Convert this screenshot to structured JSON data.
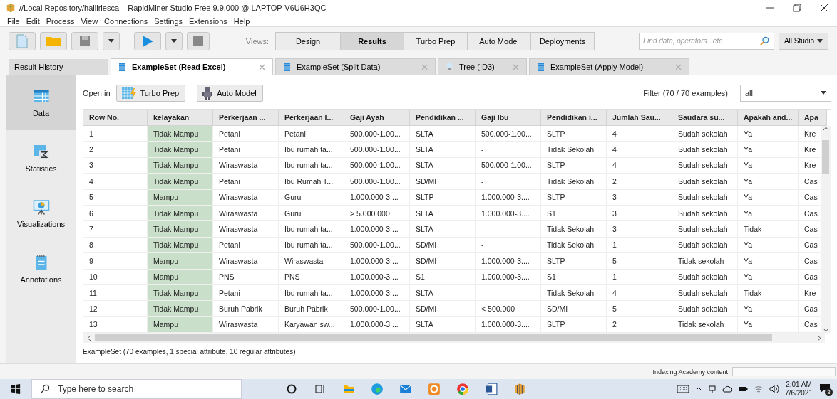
{
  "window": {
    "title": "//Local Repository/haiiiriesca – RapidMiner Studio Free 9.9.000 @ LAPTOP-V6U6H3QC"
  },
  "menu": [
    "File",
    "Edit",
    "Process",
    "View",
    "Connections",
    "Settings",
    "Extensions",
    "Help"
  ],
  "views": {
    "label": "Views:",
    "items": [
      {
        "label": "Design",
        "selected": false
      },
      {
        "label": "Results",
        "selected": true
      },
      {
        "label": "Turbo Prep",
        "selected": false
      },
      {
        "label": "Auto Model",
        "selected": false
      },
      {
        "label": "Deployments",
        "selected": false
      }
    ]
  },
  "search": {
    "placeholder": "Find data, operators...etc",
    "scope": "All Studio"
  },
  "result_history": "Result History",
  "tabs": [
    {
      "label": "ExampleSet (Read Excel)",
      "kind": "data",
      "selected": true
    },
    {
      "label": "ExampleSet (Split Data)",
      "kind": "data",
      "selected": false
    },
    {
      "label": "Tree (ID3)",
      "kind": "model",
      "selected": false
    },
    {
      "label": "ExampleSet (Apply Model)",
      "kind": "data",
      "selected": false
    }
  ],
  "sidebar": [
    {
      "label": "Data",
      "kind": "data",
      "selected": true
    },
    {
      "label": "Statistics",
      "kind": "statistics",
      "selected": false
    },
    {
      "label": "Visualizations",
      "kind": "visualizations",
      "selected": false
    },
    {
      "label": "Annotations",
      "kind": "annotations",
      "selected": false
    }
  ],
  "open_in": {
    "label": "Open in",
    "buttons": [
      {
        "label": "Turbo Prep",
        "kind": "turbo"
      },
      {
        "label": "Auto Model",
        "kind": "robot"
      }
    ]
  },
  "filter": {
    "label": "Filter (70 / 70 examples):",
    "value": "all"
  },
  "table": {
    "columns": [
      {
        "label": "Row No.",
        "highlighted": false
      },
      {
        "label": "kelayakan",
        "highlighted": true
      },
      {
        "label": "Perkerjaan ...",
        "highlighted": false
      },
      {
        "label": "Perkerjaan I...",
        "highlighted": false
      },
      {
        "label": "Gaji Ayah",
        "highlighted": false
      },
      {
        "label": "Pendidikan ...",
        "highlighted": false
      },
      {
        "label": "Gaji Ibu",
        "highlighted": false
      },
      {
        "label": "Pendidikan i...",
        "highlighted": false
      },
      {
        "label": "Jumlah Sau...",
        "highlighted": false
      },
      {
        "label": "Saudara su...",
        "highlighted": false
      },
      {
        "label": "Apakah and...",
        "highlighted": false
      },
      {
        "label": "Apa",
        "highlighted": false
      }
    ],
    "rows": [
      [
        "1",
        "Tidak Mampu",
        "Petani",
        "Petani",
        "500.000-1.00...",
        "SLTA",
        "500.000-1.00...",
        "SLTP",
        "4",
        "Sudah sekolah",
        "Ya",
        "Kre"
      ],
      [
        "2",
        "Tidak Mampu",
        "Petani",
        "Ibu rumah ta...",
        "500.000-1.00...",
        "SLTA",
        "-",
        "Tidak Sekolah",
        "4",
        "Sudah sekolah",
        "Ya",
        "Kre"
      ],
      [
        "3",
        "Tidak Mampu",
        "Wiraswasta",
        "Ibu rumah ta...",
        "500.000-1.00...",
        "SLTA",
        "500.000-1.00...",
        "SLTP",
        "4",
        "Sudah sekolah",
        "Ya",
        "Kre"
      ],
      [
        "4",
        "Tidak Mampu",
        "Petani",
        "Ibu Rumah T...",
        "500.000-1.00...",
        "SD/MI",
        "-",
        "Tidak Sekolah",
        "2",
        "Sudah sekolah",
        "Ya",
        "Cas"
      ],
      [
        "5",
        "Mampu",
        "Wiraswasta",
        "Guru",
        "1.000.000-3....",
        "SLTP",
        "1.000.000-3....",
        "SLTP",
        "3",
        "Sudah sekolah",
        "Ya",
        "Cas"
      ],
      [
        "6",
        "Tidak Mampu",
        "Wiraswasta",
        "Guru",
        "> 5.000.000",
        "SLTA",
        "1.000.000-3....",
        "S1",
        "3",
        "Sudah sekolah",
        "Ya",
        "Cas"
      ],
      [
        "7",
        "Tidak Mampu",
        "Wiraswasta",
        "Ibu rumah ta...",
        "1.000.000-3....",
        "SLTA",
        "-",
        "Tidak Sekolah",
        "3",
        "Sudah sekolah",
        "Tidak",
        "Cas"
      ],
      [
        "8",
        "Tidak Mampu",
        "Petani",
        "Ibu rumah ta...",
        "500.000-1.00...",
        "SD/MI",
        "-",
        "Tidak Sekolah",
        "1",
        "Sudah sekolah",
        "Ya",
        "Cas"
      ],
      [
        "9",
        "Mampu",
        "Wiraswasta",
        "Wiraswasta",
        "1.000.000-3....",
        "SD/MI",
        "1.000.000-3....",
        "SLTP",
        "5",
        "Tidak sekolah",
        "Ya",
        "Cas"
      ],
      [
        "10",
        "Mampu",
        "PNS",
        "PNS",
        "1.000.000-3....",
        "S1",
        "1.000.000-3....",
        "S1",
        "1",
        "Sudah sekolah",
        "Ya",
        "Cas"
      ],
      [
        "11",
        "Tidak Mampu",
        "Petani",
        "Ibu rumah ta...",
        "1.000.000-3....",
        "SLTA",
        "-",
        "Tidak Sekolah",
        "4",
        "Sudah sekolah",
        "Tidak",
        "Kre"
      ],
      [
        "12",
        "Tidak Mampu",
        "Buruh Pabrik",
        "Buruh Pabrik",
        "500.000-1.00...",
        "SD/MI",
        "< 500.000",
        "SD/MI",
        "5",
        "Sudah sekolah",
        "Ya",
        "Cas"
      ],
      [
        "13",
        "Mampu",
        "Wiraswasta",
        "Karyawan sw...",
        "1.000.000-3....",
        "SLTA",
        "1.000.000-3....",
        "SLTP",
        "2",
        "Tidak sekolah",
        "Ya",
        "Cas"
      ]
    ]
  },
  "summary": "ExampleSet (70 examples, 1 special attribute, 10 regular attributes)",
  "status_bar": "Indexing Academy content",
  "taskbar": {
    "search_placeholder": "Type here to search",
    "time": "2:01 AM",
    "date": "7/6/2021",
    "notifications": "3"
  }
}
